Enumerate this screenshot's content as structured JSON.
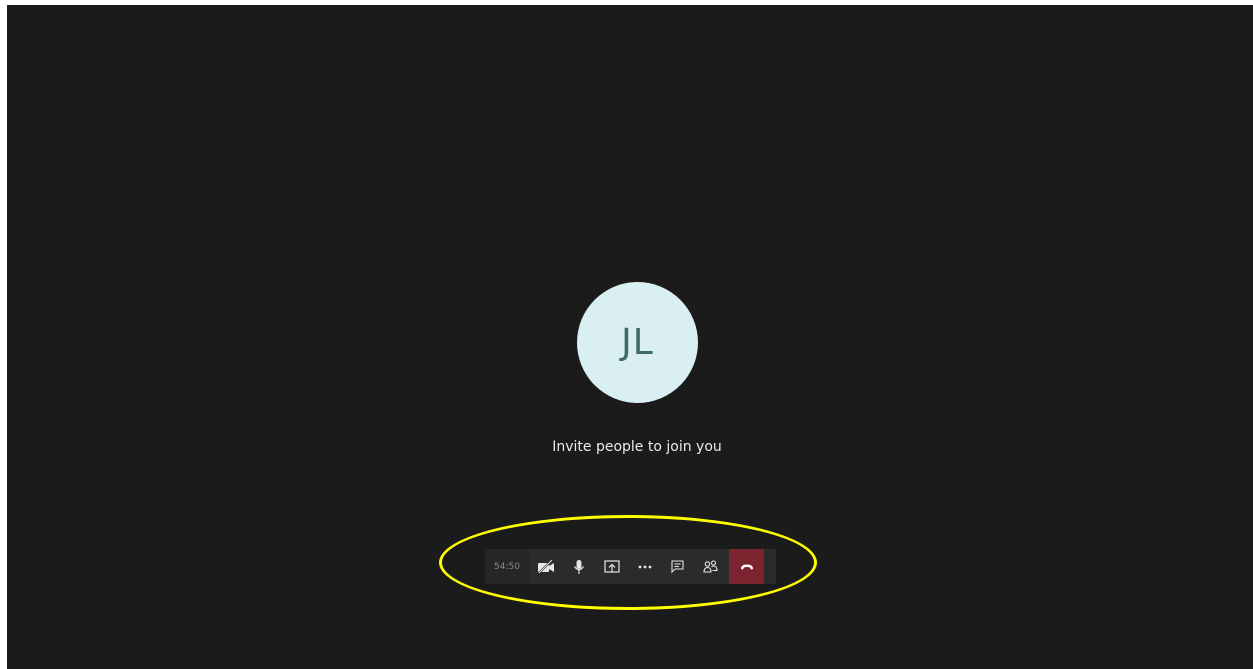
{
  "avatar": {
    "initials": "JL"
  },
  "message": {
    "text": "Invite people to join you"
  },
  "toolbar": {
    "timer": "54:50",
    "buttons": [
      {
        "icon": "video-off-icon"
      },
      {
        "icon": "microphone-icon"
      },
      {
        "icon": "share-screen-icon"
      },
      {
        "icon": "more-options-icon"
      },
      {
        "icon": "chat-icon"
      },
      {
        "icon": "participants-icon"
      },
      {
        "icon": "hang-up-icon"
      }
    ]
  },
  "colors": {
    "background": "#1b1b1b",
    "avatar_bg": "#d9eff2",
    "avatar_text": "#3f6868",
    "toolbar_bg": "#2b2b2b",
    "hangup_bg": "#7b2430",
    "highlight": "#ffff00"
  }
}
